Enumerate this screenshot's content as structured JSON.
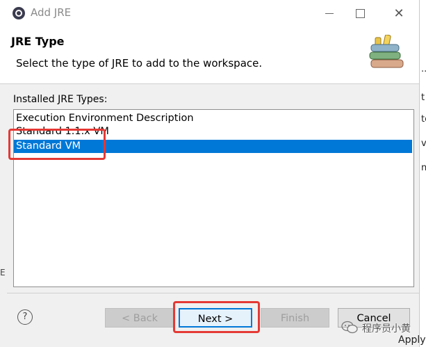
{
  "window": {
    "title": "Add JRE"
  },
  "header": {
    "title": "JRE Type",
    "description": "Select the type of JRE to add to the workspace."
  },
  "list": {
    "label": "Installed JRE Types:",
    "items": [
      {
        "label": "Execution Environment Description",
        "selected": false
      },
      {
        "label": "Standard 1.1.x VM",
        "selected": false
      },
      {
        "label": "Standard VM",
        "selected": true
      }
    ]
  },
  "buttons": {
    "help": "?",
    "back": "< Back",
    "next": "Next >",
    "finish": "Finish",
    "cancel": "Cancel"
  },
  "background": {
    "strip_texts": [
      "...",
      "t",
      "te",
      "ve",
      "n."
    ],
    "apply": "Apply",
    "left_char": "E"
  },
  "watermark": {
    "text": "程序员小黄"
  },
  "colors": {
    "selection": "#0078d7",
    "annotation": "#e53935"
  }
}
